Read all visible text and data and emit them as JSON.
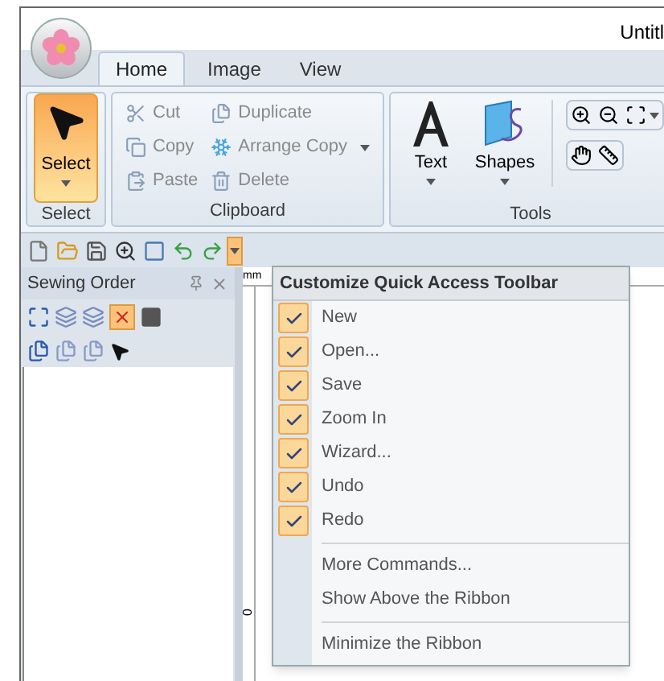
{
  "window": {
    "title": "Untitl"
  },
  "tabs": [
    {
      "label": "Home",
      "selected": true
    },
    {
      "label": "Image",
      "selected": false
    },
    {
      "label": "View",
      "selected": false
    }
  ],
  "ribbon": {
    "groups": [
      {
        "label": "Select",
        "kind": "select",
        "buttons": [
          {
            "label": "Select",
            "active": true
          }
        ]
      },
      {
        "label": "Clipboard",
        "kind": "clipboard",
        "buttons": [
          {
            "label": "Cut",
            "disabled": true,
            "dropdown": false
          },
          {
            "label": "Duplicate",
            "disabled": true,
            "dropdown": false
          },
          {
            "label": "Copy",
            "disabled": true,
            "dropdown": false
          },
          {
            "label": "Arrange Copy",
            "disabled": true,
            "dropdown": true
          },
          {
            "label": "Paste",
            "disabled": true,
            "dropdown": false
          },
          {
            "label": "Delete",
            "disabled": true,
            "dropdown": false
          }
        ]
      },
      {
        "label": "Tools",
        "kind": "tools",
        "buttons": [
          {
            "label": "Text"
          },
          {
            "label": "Shapes"
          }
        ]
      }
    ]
  },
  "pane": {
    "title": "Sewing Order"
  },
  "ruler": {
    "unit": "mm",
    "mark": "0"
  },
  "menu": {
    "title": "Customize Quick Access Toolbar",
    "items": [
      {
        "kind": "check",
        "label": "New",
        "checked": true
      },
      {
        "kind": "check",
        "label": "Open...",
        "checked": true
      },
      {
        "kind": "check",
        "label": "Save",
        "checked": true
      },
      {
        "kind": "check",
        "label": "Zoom In",
        "checked": true
      },
      {
        "kind": "check",
        "label": "Wizard...",
        "checked": true
      },
      {
        "kind": "check",
        "label": "Undo",
        "checked": true
      },
      {
        "kind": "check",
        "label": "Redo",
        "checked": true
      },
      {
        "kind": "separator"
      },
      {
        "kind": "command",
        "label": "More Commands..."
      },
      {
        "kind": "command",
        "label": "Show Above the Ribbon"
      },
      {
        "kind": "separator"
      },
      {
        "kind": "command",
        "label": "Minimize the Ribbon"
      }
    ]
  }
}
